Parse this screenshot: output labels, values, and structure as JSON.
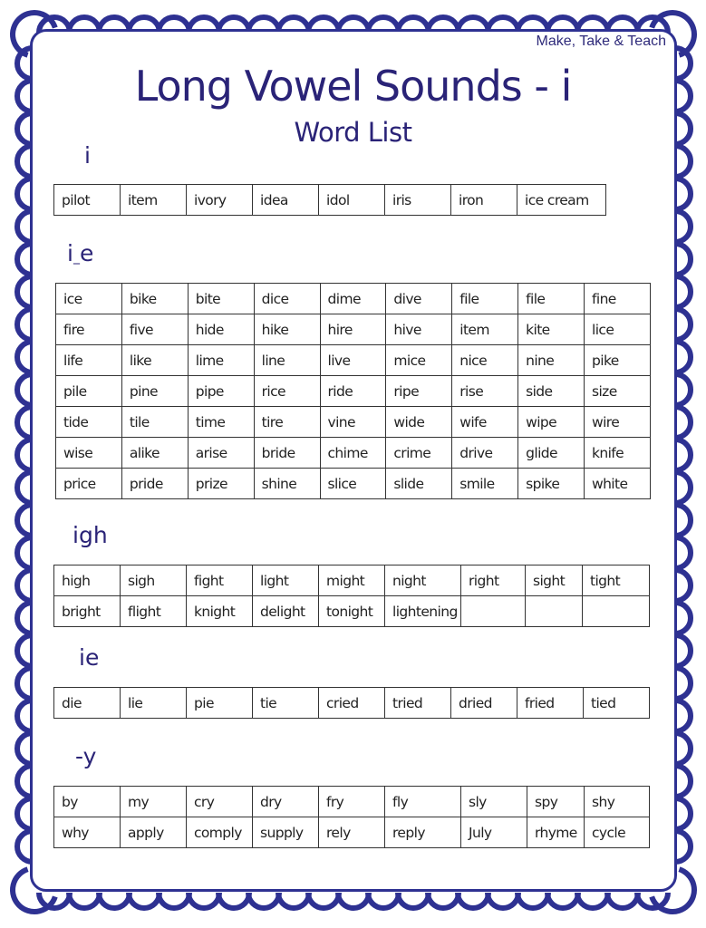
{
  "brand": "Make, Take & Teach",
  "title": "Long Vowel Sounds -  i",
  "subtitle": "Word List",
  "colors": {
    "border": "#2e3192",
    "heading": "#2a2377",
    "table_line": "#333333",
    "text": "#222222"
  },
  "sections": [
    {
      "label": "i",
      "rows": [
        [
          "pilot",
          "item",
          "ivory",
          "idea",
          "idol",
          "iris",
          "iron",
          "ice cream"
        ]
      ]
    },
    {
      "label": "i_e",
      "rows": [
        [
          "ice",
          "bike",
          "bite",
          "dice",
          "dime",
          "dive",
          "file",
          "file",
          "fine"
        ],
        [
          "fire",
          "five",
          "hide",
          "hike",
          "hire",
          "hive",
          "item",
          "kite",
          "lice"
        ],
        [
          "life",
          "like",
          "lime",
          "line",
          "live",
          "mice",
          "nice",
          "nine",
          "pike"
        ],
        [
          "pile",
          "pine",
          "pipe",
          "rice",
          "ride",
          "ripe",
          "rise",
          "side",
          "size"
        ],
        [
          "tide",
          "tile",
          "time",
          "tire",
          "vine",
          "wide",
          "wife",
          "wipe",
          "wire"
        ],
        [
          "wise",
          "alike",
          "arise",
          "bride",
          "chime",
          "crime",
          "drive",
          "glide",
          "knife"
        ],
        [
          "price",
          "pride",
          "prize",
          "shine",
          "slice",
          "slide",
          "smile",
          "spike",
          "white"
        ]
      ]
    },
    {
      "label": "igh",
      "rows": [
        [
          "high",
          "sigh",
          "fight",
          "light",
          "might",
          "night",
          "right",
          "sight",
          "tight"
        ],
        [
          "bright",
          "flight",
          "knight",
          "delight",
          "tonight",
          "lightening",
          "",
          "",
          ""
        ]
      ]
    },
    {
      "label": "ie",
      "rows": [
        [
          "die",
          "lie",
          "pie",
          "tie",
          "cried",
          "tried",
          "dried",
          "fried",
          "tied"
        ]
      ]
    },
    {
      "label": "-y",
      "rows": [
        [
          "by",
          "my",
          "cry",
          "dry",
          "fry",
          "fly",
          "sly",
          "spy",
          "shy"
        ],
        [
          "why",
          "apply",
          "comply",
          "supply",
          "rely",
          "reply",
          "July",
          "rhyme",
          "cycle"
        ]
      ]
    }
  ]
}
